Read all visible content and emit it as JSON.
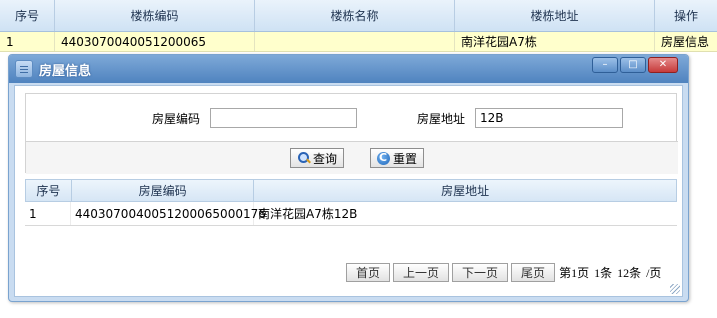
{
  "background_table": {
    "columns": [
      "序号",
      "楼栋编码",
      "楼栋名称",
      "楼栋地址",
      "操作"
    ],
    "rows": [
      [
        "1",
        "4403070040051200065",
        "",
        "南洋花园A7栋",
        "房屋信息"
      ]
    ]
  },
  "dialog": {
    "title": "房屋信息",
    "title_icon": "window-icon",
    "controls": {
      "minimize": "–",
      "maximize": "□",
      "close": "✕"
    },
    "form": {
      "code_label": "房屋编码",
      "code_value": "",
      "address_label": "房屋地址",
      "address_value": "12B",
      "search_label": "查询",
      "reset_label": "重置"
    },
    "grid": {
      "columns": [
        "序号",
        "房屋编码",
        "房屋地址"
      ],
      "rows": [
        [
          "1",
          "440307004005120006500017​6",
          "南洋花园A7栋12B"
        ]
      ]
    },
    "pager": {
      "first": "首页",
      "prev": "上一页",
      "next": "下一页",
      "last": "尾页",
      "info": "第1页 1条 12条 /页"
    }
  }
}
